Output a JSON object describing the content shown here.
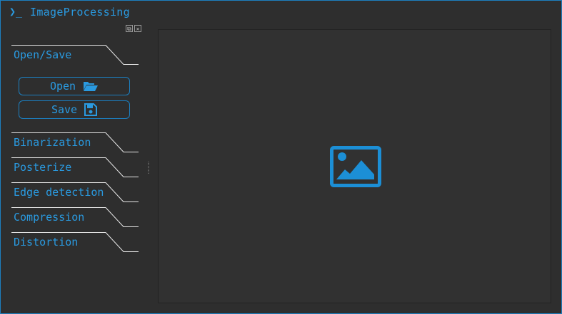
{
  "window": {
    "prompt_symbol": "❯_",
    "title": "ImageProcessing",
    "accent_color": "#2a9ae0"
  },
  "dock": {
    "buttons": [
      {
        "icon": "undock-icon",
        "glyph": "⧉"
      },
      {
        "icon": "close-icon",
        "glyph": "✕"
      }
    ]
  },
  "sidebar": {
    "sections": [
      {
        "label": "Open/Save"
      },
      {
        "label": "Binarization"
      },
      {
        "label": "Posterize"
      },
      {
        "label": "Edge detection"
      },
      {
        "label": "Compression"
      },
      {
        "label": "Distortion"
      }
    ],
    "open_button": {
      "label": "Open",
      "icon": "folder-open-icon"
    },
    "save_button": {
      "label": "Save",
      "icon": "floppy-disk-icon"
    }
  },
  "canvas": {
    "placeholder_icon": "image-icon"
  }
}
